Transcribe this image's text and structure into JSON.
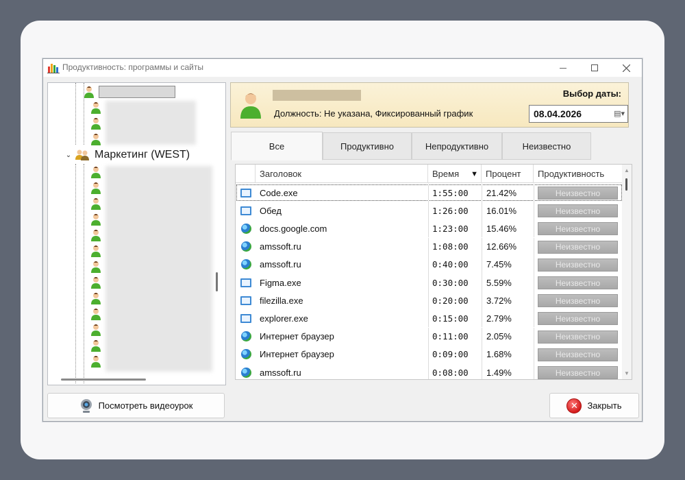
{
  "window": {
    "title": "Продуктивность: программы и сайты"
  },
  "tree": {
    "group_label": "Маркетинг (WEST)"
  },
  "employee": {
    "position_text": "Должность: Не указана, Фиксированный график"
  },
  "date_picker": {
    "label": "Выбор даты:",
    "value": "08.04.2026"
  },
  "tabs": [
    {
      "label": "Все",
      "active": true
    },
    {
      "label": "Продуктивно",
      "active": false
    },
    {
      "label": "Непродуктивно",
      "active": false
    },
    {
      "label": "Неизвестно",
      "active": false
    }
  ],
  "table": {
    "columns": [
      "Заголовок",
      "Время",
      "Процент",
      "Продуктивность"
    ],
    "sort_column": "Время",
    "rows": [
      {
        "icon": "monitor-icon",
        "title": "Code.exe",
        "time": "1:55:00",
        "percent": "21.42%",
        "productivity": "Неизвестно",
        "selected": true
      },
      {
        "icon": "monitor-icon",
        "title": "Обед",
        "time": "1:26:00",
        "percent": "16.01%",
        "productivity": "Неизвестно"
      },
      {
        "icon": "globe-icon",
        "title": "docs.google.com",
        "time": "1:23:00",
        "percent": "15.46%",
        "productivity": "Неизвестно"
      },
      {
        "icon": "globe-icon",
        "title": "amssoft.ru",
        "time": "1:08:00",
        "percent": "12.66%",
        "productivity": "Неизвестно"
      },
      {
        "icon": "globe-icon",
        "title": "amssoft.ru",
        "time": "0:40:00",
        "percent": "7.45%",
        "productivity": "Неизвестно"
      },
      {
        "icon": "monitor-icon",
        "title": "Figma.exe",
        "time": "0:30:00",
        "percent": "5.59%",
        "productivity": "Неизвестно"
      },
      {
        "icon": "monitor-icon",
        "title": "filezilla.exe",
        "time": "0:20:00",
        "percent": "3.72%",
        "productivity": "Неизвестно"
      },
      {
        "icon": "monitor-icon",
        "title": "explorer.exe",
        "time": "0:15:00",
        "percent": "2.79%",
        "productivity": "Неизвестно"
      },
      {
        "icon": "globe-icon",
        "title": "Интернет браузер",
        "time": "0:11:00",
        "percent": "2.05%",
        "productivity": "Неизвестно"
      },
      {
        "icon": "globe-icon",
        "title": "Интернет браузер",
        "time": "0:09:00",
        "percent": "1.68%",
        "productivity": "Неизвестно"
      },
      {
        "icon": "globe-icon",
        "title": "amssoft.ru",
        "time": "0:08:00",
        "percent": "1.49%",
        "productivity": "Неизвестно"
      }
    ]
  },
  "buttons": {
    "video_label": "Посмотреть видеоурок",
    "close_label": "Закрыть"
  },
  "colors": {
    "backdrop": "#5f6673",
    "header_gradient_top": "#fbf2d8",
    "header_gradient_bottom": "#f7e8bf",
    "productivity_button": "#b2b2b2"
  }
}
